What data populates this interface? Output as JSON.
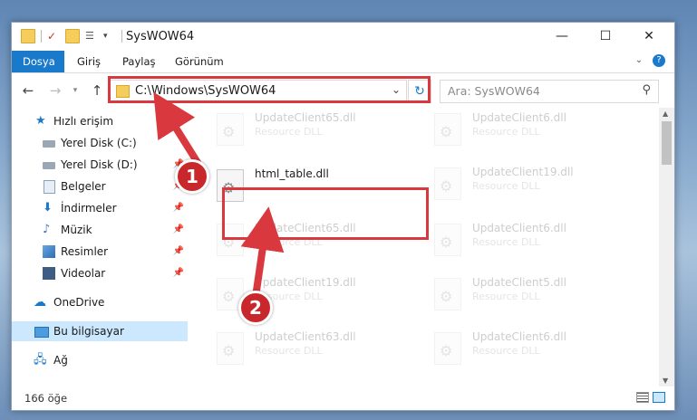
{
  "window": {
    "title": "SysWOW64"
  },
  "ribbon": {
    "tabs": [
      {
        "label": "Dosya"
      },
      {
        "label": "Giriş"
      },
      {
        "label": "Paylaş"
      },
      {
        "label": "Görünüm"
      }
    ],
    "help": "?"
  },
  "nav": {
    "address": "C:\\Windows\\SysWOW64",
    "search_placeholder": "Ara: SysWOW64"
  },
  "sidebar": {
    "items": [
      {
        "label": "Hızlı erişim"
      },
      {
        "label": "Yerel Disk (C:)"
      },
      {
        "label": "Yerel Disk (D:)"
      },
      {
        "label": "Belgeler"
      },
      {
        "label": "İndirmeler"
      },
      {
        "label": "Müzik"
      },
      {
        "label": "Resimler"
      },
      {
        "label": "Videolar"
      },
      {
        "label": "OneDrive"
      },
      {
        "label": "Bu bilgisayar"
      },
      {
        "label": "Ağ"
      }
    ]
  },
  "files": {
    "highlighted": {
      "name": "html_table.dll"
    },
    "left": [
      {
        "name": "UpdateClient65.dll",
        "type": "Resource DLL"
      },
      {
        "name": "UpdateClient65.dll",
        "type": "Resource DLL"
      },
      {
        "name": "UpdateClient19.dll",
        "type": "Resource DLL"
      },
      {
        "name": "UpdateClient63.dll",
        "type": "Resource DLL"
      }
    ],
    "right": [
      {
        "name": "UpdateClient6.dll",
        "type": "Resource DLL"
      },
      {
        "name": "UpdateClient19.dll",
        "type": "Resource DLL"
      },
      {
        "name": "UpdateClient6.dll",
        "type": "Resource DLL"
      },
      {
        "name": "UpdateClient5.dll",
        "type": "Resource DLL"
      },
      {
        "name": "UpdateClient6.dll",
        "type": "Resource DLL"
      }
    ]
  },
  "status": {
    "count": "166 öğe"
  },
  "annotations": [
    {
      "label": "1"
    },
    {
      "label": "2"
    }
  ],
  "colors": {
    "accent": "#1979ca",
    "highlight_box": "#d9383f",
    "badge": "#c8282c"
  }
}
